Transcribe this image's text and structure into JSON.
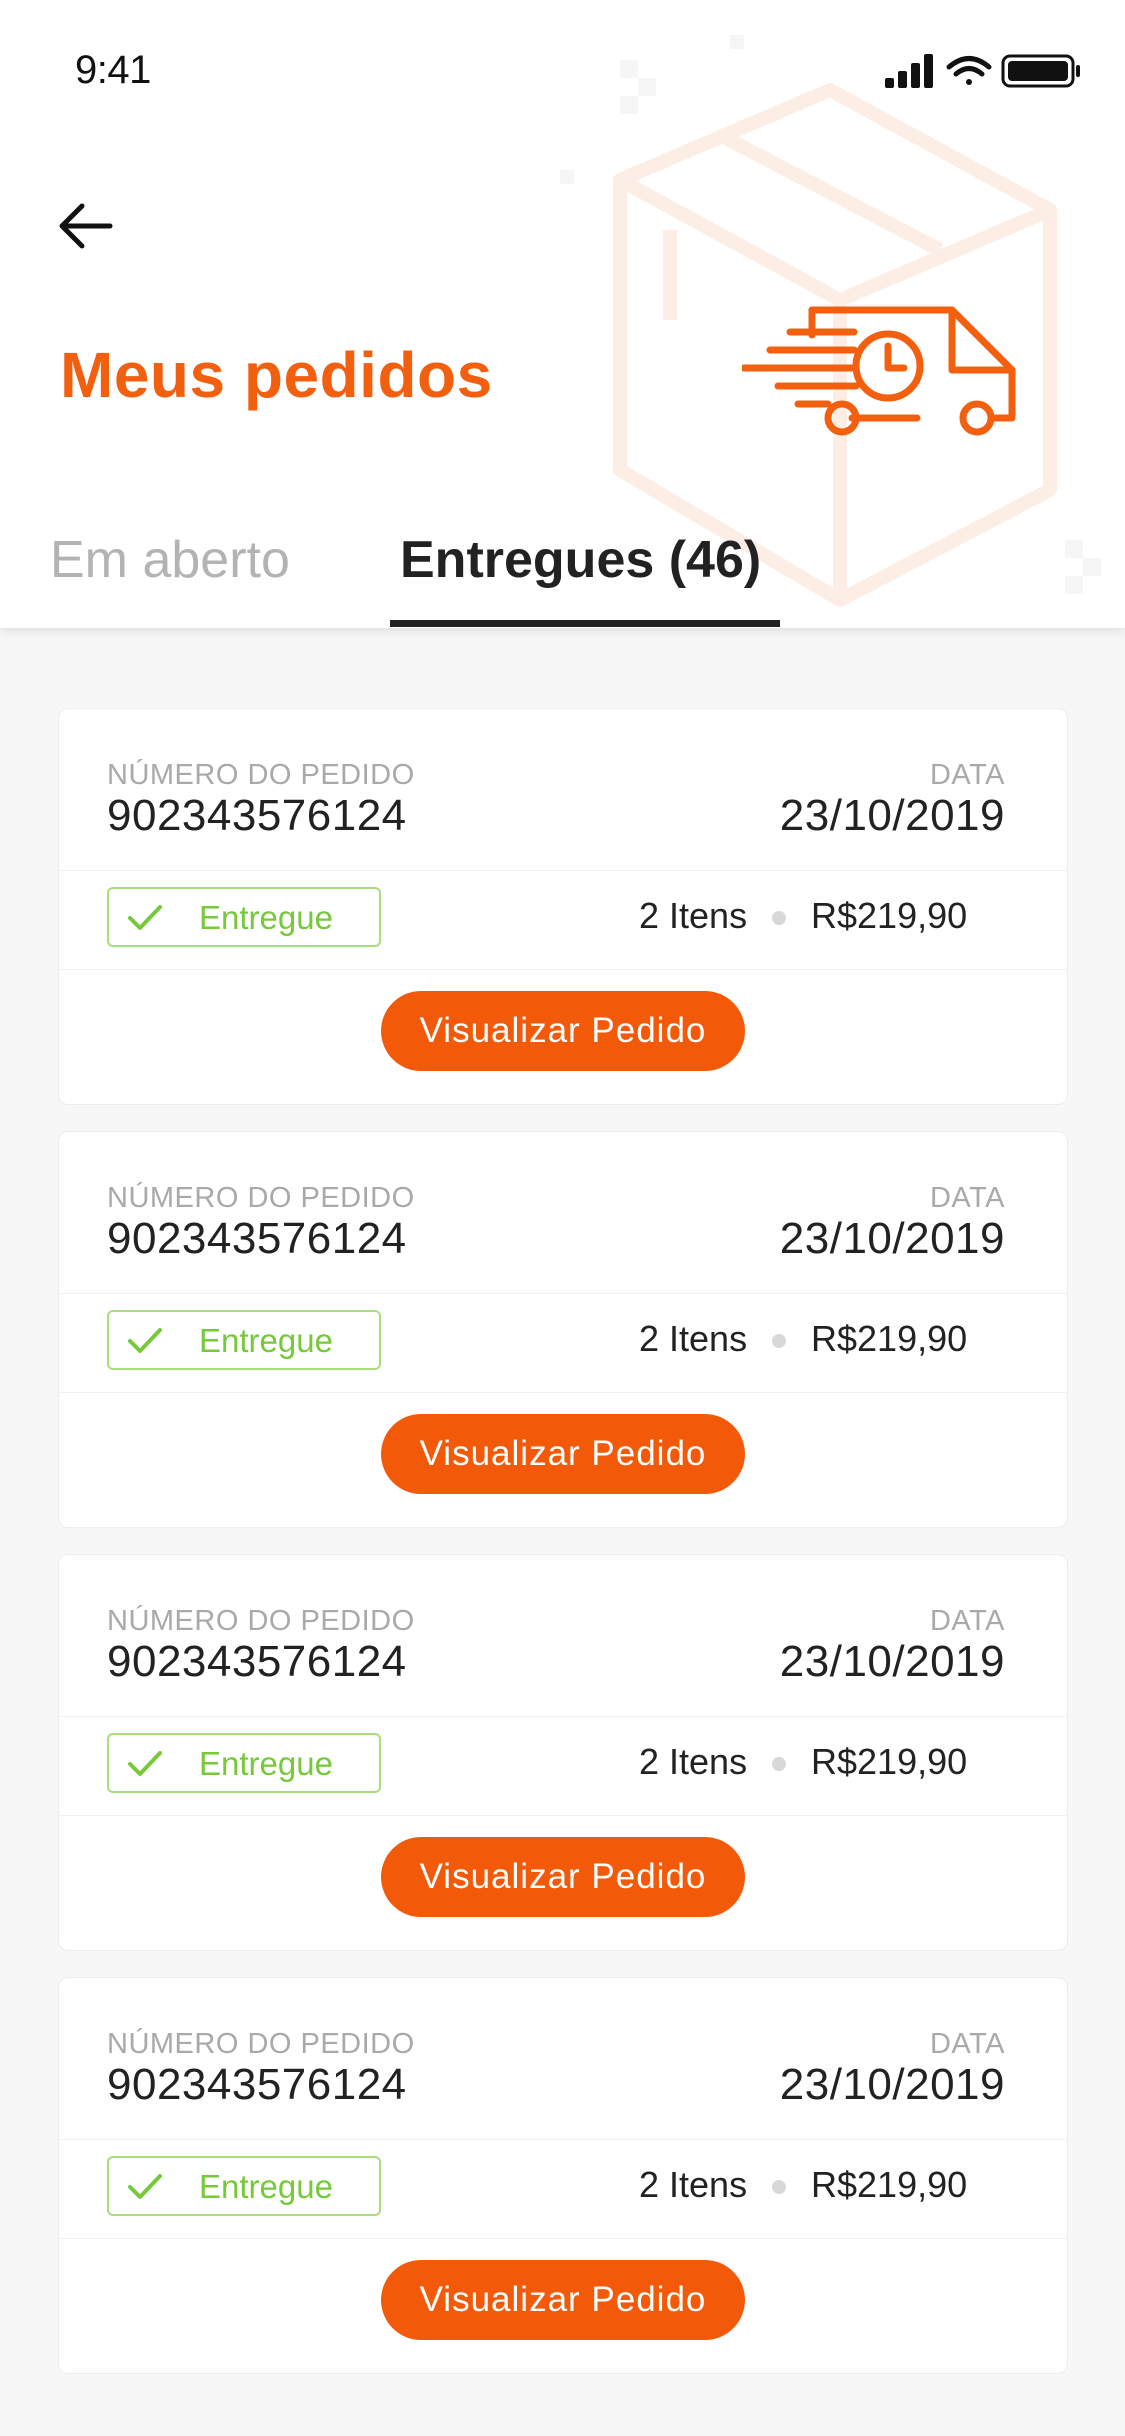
{
  "status_bar": {
    "time": "9:41"
  },
  "header": {
    "title": "Meus pedidos"
  },
  "tabs": [
    {
      "label": "Em aberto",
      "active": false
    },
    {
      "label": "Entregues (46)",
      "active": true
    }
  ],
  "orders": [
    {
      "number_label": "NÚMERO DO PEDIDO",
      "number": "902343576124",
      "date_label": "DATA",
      "date": "23/10/2019",
      "status": "Entregue",
      "items": "2 Itens",
      "price": "R$219,90",
      "action_label": "Visualizar Pedido"
    },
    {
      "number_label": "NÚMERO DO PEDIDO",
      "number": "902343576124",
      "date_label": "DATA",
      "date": "23/10/2019",
      "status": "Entregue",
      "items": "2 Itens",
      "price": "R$219,90",
      "action_label": "Visualizar Pedido"
    },
    {
      "number_label": "NÚMERO DO PEDIDO",
      "number": "902343576124",
      "date_label": "DATA",
      "date": "23/10/2019",
      "status": "Entregue",
      "items": "2 Itens",
      "price": "R$219,90",
      "action_label": "Visualizar Pedido"
    },
    {
      "number_label": "NÚMERO DO PEDIDO",
      "number": "902343576124",
      "date_label": "DATA",
      "date": "23/10/2019",
      "status": "Entregue",
      "items": "2 Itens",
      "price": "R$219,90",
      "action_label": "Visualizar Pedido"
    }
  ],
  "icons": {
    "back": "arrow-left-icon",
    "truck": "delivery-truck-icon",
    "status_check": "check-icon",
    "signal": "cellular-signal-icon",
    "wifi": "wifi-icon",
    "battery": "battery-icon"
  },
  "colors": {
    "accent": "#F2600F",
    "success": "#76C93A",
    "background": "#F7F7F7",
    "card": "#FFFFFF"
  }
}
